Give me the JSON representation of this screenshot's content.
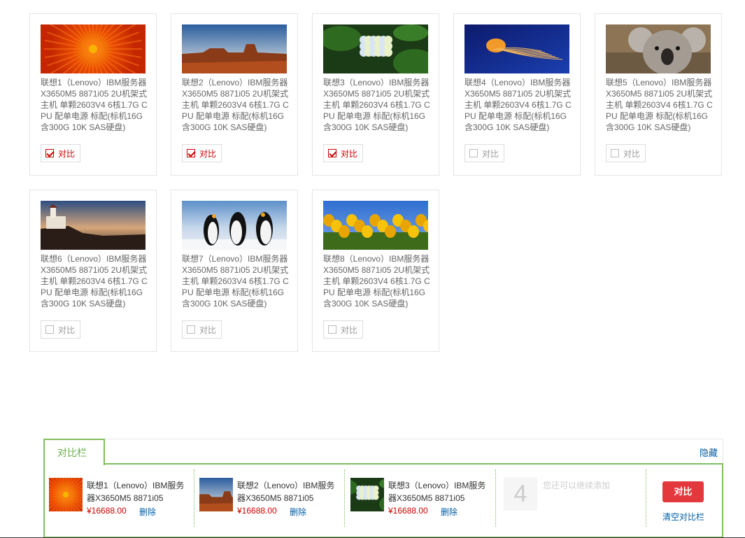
{
  "products": [
    {
      "title": "联想1（Lenovo）IBM服务器X3650M5 8871i05 2U机架式主机 单颗2603V4 6核1.7G CPU 配单电源 标配(标机16G含300G 10K SAS硬盘)",
      "compare_label": "对比",
      "checked": true,
      "image": "orange-flower"
    },
    {
      "title": "联想2（Lenovo）IBM服务器X3650M5 8871i05 2U机架式主机 单颗2603V4 6核1.7G CPU 配单电源 标配(标机16G含300G 10K SAS硬盘)",
      "compare_label": "对比",
      "checked": true,
      "image": "desert-mesa"
    },
    {
      "title": "联想3（Lenovo）IBM服务器X3650M5 8871i05 2U机架式主机 单颗2603V4 6核1.7G CPU 配单电源 标配(标机16G含300G 10K SAS硬盘)",
      "compare_label": "对比",
      "checked": true,
      "image": "hydrangea"
    },
    {
      "title": "联想4（Lenovo）IBM服务器X3650M5 8871i05 2U机架式主机 单颗2603V4 6核1.7G CPU 配单电源 标配(标机16G含300G 10K SAS硬盘)",
      "compare_label": "对比",
      "checked": false,
      "image": "jellyfish"
    },
    {
      "title": "联想5（Lenovo）IBM服务器X3650M5 8871i05 2U机架式主机 单颗2603V4 6核1.7G CPU 配单电源 标配(标机16G含300G 10K SAS硬盘)",
      "compare_label": "对比",
      "checked": false,
      "image": "koala"
    },
    {
      "title": "联想6（Lenovo）IBM服务器X3650M5 8871i05 2U机架式主机 单颗2603V4 6核1.7G CPU 配单电源 标配(标机16G含300G 10K SAS硬盘)",
      "compare_label": "对比",
      "checked": false,
      "image": "lighthouse"
    },
    {
      "title": "联想7（Lenovo）IBM服务器X3650M5 8871i05 2U机架式主机 单颗2603V4 6核1.7G CPU 配单电源 标配(标机16G含300G 10K SAS硬盘)",
      "compare_label": "对比",
      "checked": false,
      "image": "penguins"
    },
    {
      "title": "联想8（Lenovo）IBM服务器X3650M5 8871i05 2U机架式主机 单颗2603V4 6核1.7G CPU 配单电源 标配(标机16G含300G 10K SAS硬盘)",
      "compare_label": "对比",
      "checked": false,
      "image": "tulips"
    }
  ],
  "compare_bar": {
    "tab_label": "对比栏",
    "hide_label": "隐藏",
    "items": [
      {
        "title": "联想1（Lenovo）IBM服务器X3650M5 8871i05",
        "price": "¥16688.00",
        "delete_label": "删除",
        "image": "orange-flower"
      },
      {
        "title": "联想2（Lenovo）IBM服务器X3650M5 8871i05",
        "price": "¥16688.00",
        "delete_label": "删除",
        "image": "desert-mesa"
      },
      {
        "title": "联想3（Lenovo）IBM服务器X3650M5 8871i05",
        "price": "¥16688.00",
        "delete_label": "删除",
        "image": "hydrangea"
      }
    ],
    "empty_slot": {
      "number": "4",
      "hint": "您还可以继续添加"
    },
    "compare_button": "对比",
    "clear_label": "清空对比栏"
  },
  "colors": {
    "accent_green": "#7fbf5e",
    "price_red": "#cc0000",
    "link_blue": "#005ea7",
    "button_red": "#e4393c"
  }
}
